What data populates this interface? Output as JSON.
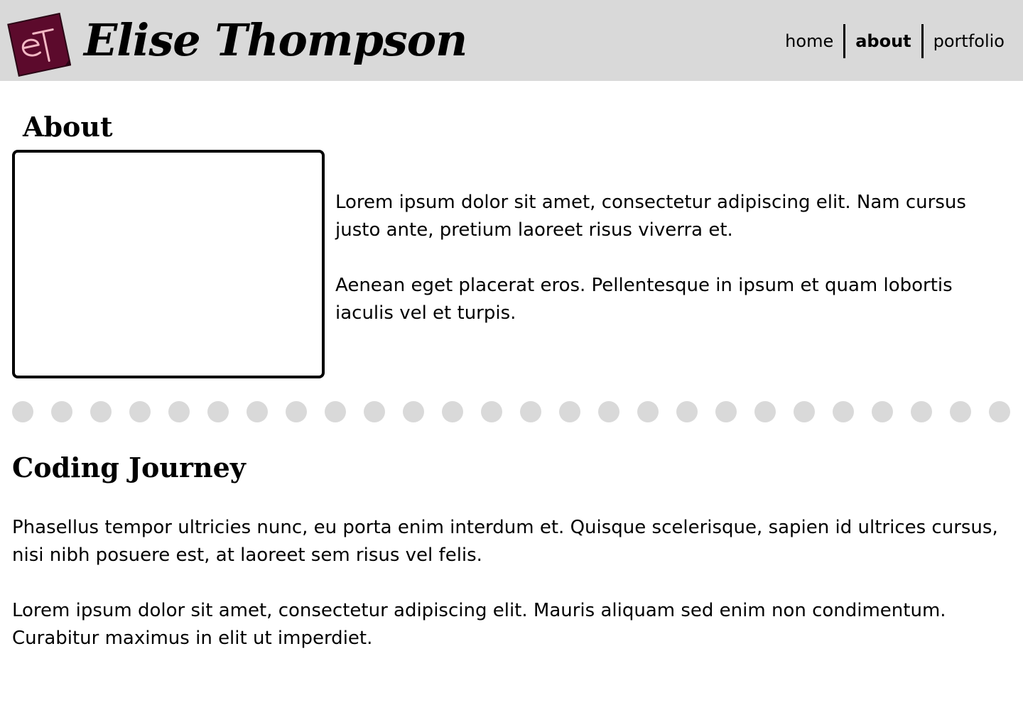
{
  "header": {
    "logo_text": "eT",
    "title": "Elise Thompson"
  },
  "nav": {
    "items": [
      {
        "label": "home",
        "active": false
      },
      {
        "label": "about",
        "active": true
      },
      {
        "label": "portfolio",
        "active": false
      }
    ]
  },
  "about": {
    "heading": "About",
    "paragraphs": [
      "Lorem ipsum dolor sit amet, consectetur adipiscing elit. Nam cursus justo ante, pretium laoreet risus viverra et.",
      "Aenean eget placerat eros. Pellentesque in ipsum et quam lobortis iaculis vel et turpis."
    ]
  },
  "journey": {
    "heading": "Coding Journey",
    "paragraphs": [
      "Phasellus tempor ultricies nunc, eu porta enim interdum et. Quisque scelerisque, sapien id ultrices cursus, nisi nibh posuere est, at laoreet sem risus vel felis.",
      "Lorem ipsum dolor sit amet, consectetur adipiscing elit. Mauris aliquam sed enim non condimentum. Curabitur maximus in elit ut imperdiet."
    ]
  },
  "colors": {
    "header_bg": "#d9d9d9",
    "logo_bg": "#5c0a2c",
    "logo_text": "#f3b8c4",
    "divider_dot": "#d9d9d9"
  }
}
